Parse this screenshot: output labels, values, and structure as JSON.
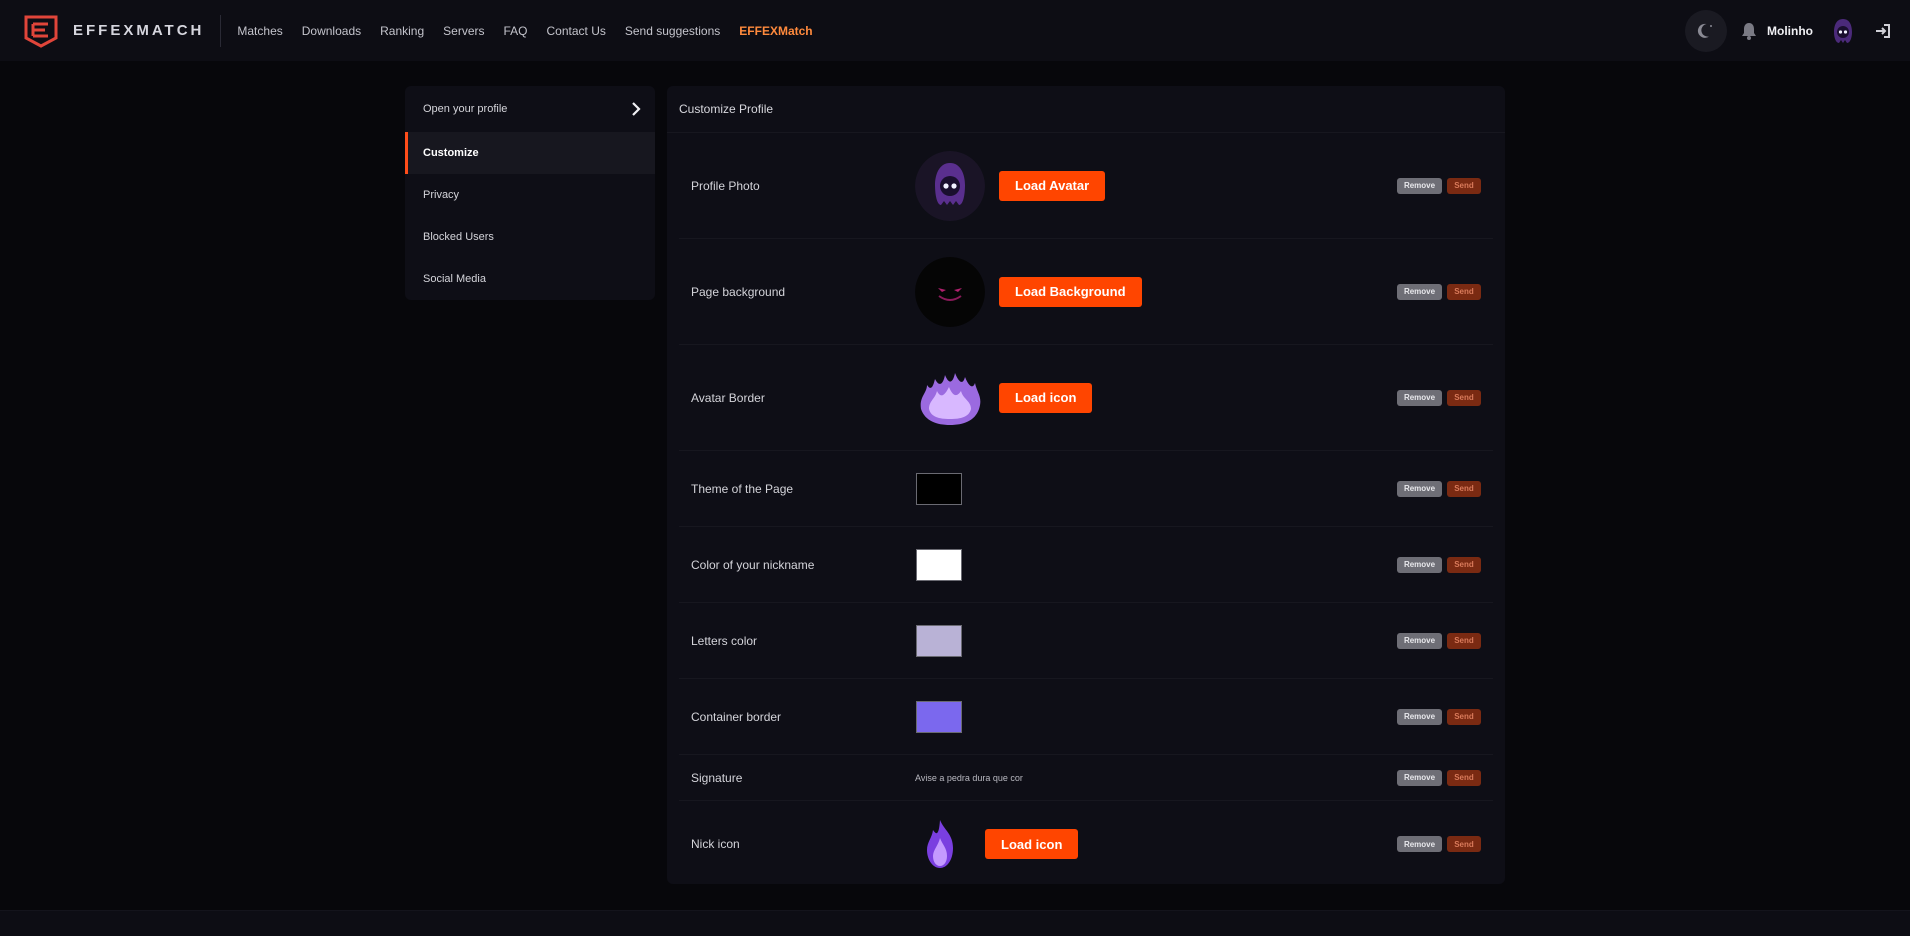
{
  "brand": {
    "name": "EFFEXMATCH",
    "accent": "#ff4500",
    "logo_color": "#e0453a"
  },
  "nav": {
    "links": [
      "Matches",
      "Downloads",
      "Ranking",
      "Servers",
      "FAQ",
      "Contact Us",
      "Send suggestions",
      "EFFEXMatch"
    ],
    "active": "EFFEXMatch"
  },
  "user": {
    "name": "Molinho"
  },
  "sidebar": {
    "items": [
      {
        "label": "Open your profile",
        "icon": "chevron-right-icon"
      },
      {
        "label": "Customize",
        "active": true
      },
      {
        "label": "Privacy"
      },
      {
        "label": "Blocked Users"
      },
      {
        "label": "Social Media"
      }
    ]
  },
  "panel": {
    "title": "Customize Profile",
    "remove_label": "Remove",
    "send_label": "Send",
    "rows": [
      {
        "label": "Profile Photo",
        "button": "Load Avatar",
        "image": "hooded-ghost-avatar"
      },
      {
        "label": "Page background",
        "button": "Load Background",
        "image": "dark-grin-background"
      },
      {
        "label": "Avatar Border",
        "button": "Load icon",
        "image": "purple-flame-border"
      },
      {
        "label": "Theme of the Page",
        "color": "#000000"
      },
      {
        "label": "Color of your nickname",
        "color": "#ffffff"
      },
      {
        "label": "Letters color",
        "color": "#b9b2d6"
      },
      {
        "label": "Container border",
        "color": "#7b68ee"
      },
      {
        "label": "Signature",
        "value": "Avise a pedra dura que cor"
      },
      {
        "label": "Nick icon",
        "button": "Load icon",
        "image": "purple-flame-icon"
      }
    ]
  }
}
